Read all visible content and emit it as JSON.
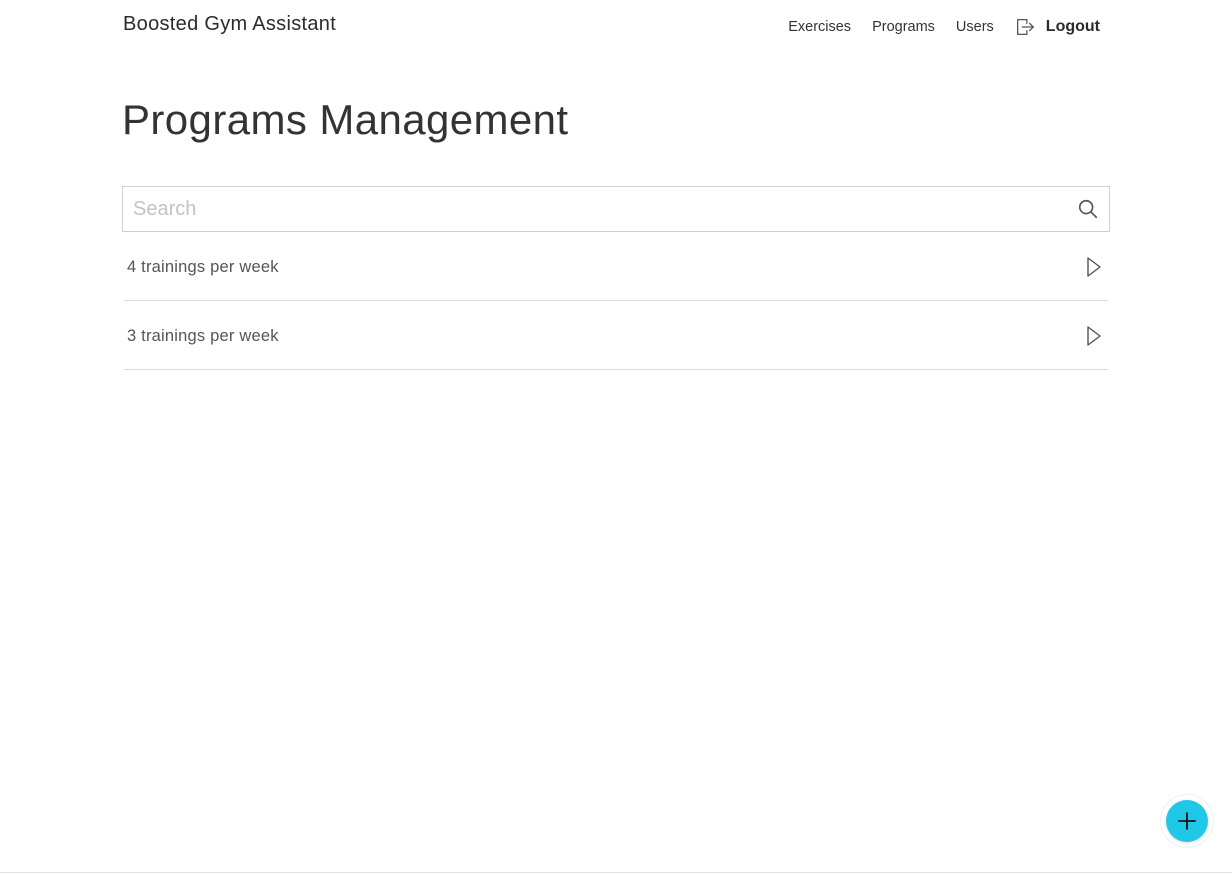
{
  "header": {
    "brand": "Boosted Gym Assistant",
    "nav": [
      {
        "label": "Exercises"
      },
      {
        "label": "Programs"
      },
      {
        "label": "Users"
      }
    ],
    "logout_label": "Logout",
    "logout_icon": "logout-icon"
  },
  "page": {
    "title": "Programs Management"
  },
  "search": {
    "placeholder": "Search",
    "value": "",
    "icon": "search-icon"
  },
  "programs": [
    {
      "label": "4 trainings per week",
      "icon": "chevron-right-icon"
    },
    {
      "label": "3 trainings per week",
      "icon": "chevron-right-icon"
    }
  ],
  "fab": {
    "icon": "plus-icon",
    "color": "#1ec8e6"
  }
}
